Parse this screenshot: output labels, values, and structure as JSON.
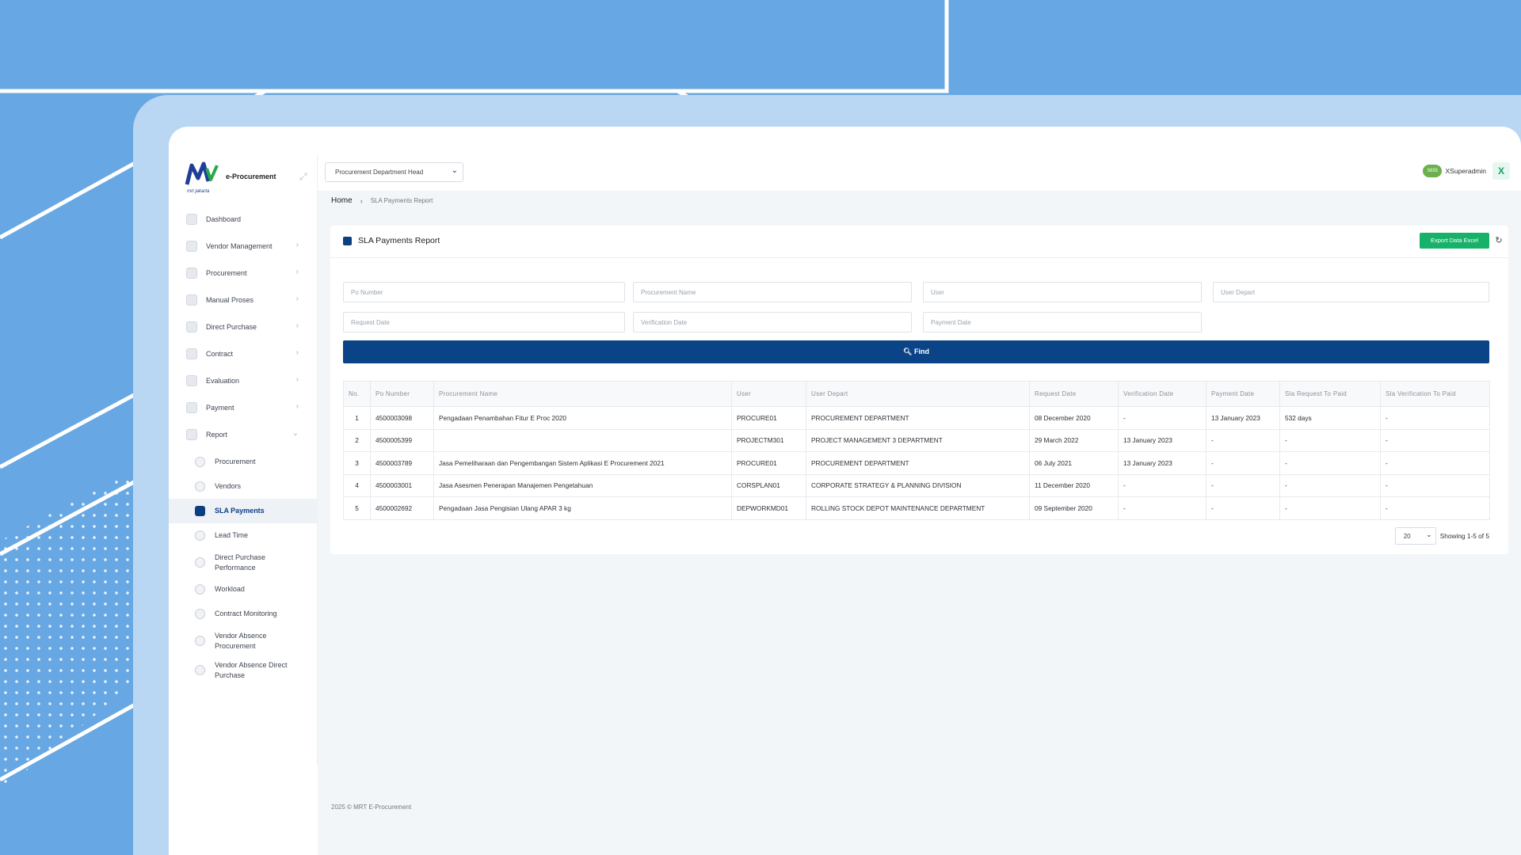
{
  "brand": {
    "name": "e-Procurement",
    "logo_text": "mrt jakarta"
  },
  "role": {
    "selected": "Procurement Department Head"
  },
  "user": {
    "badge": "5655",
    "name": "XSuperadmin",
    "close": "X"
  },
  "sidebar": {
    "items": [
      {
        "label": "Dashboard",
        "icon": "dashboard-icon",
        "chevron": ""
      },
      {
        "label": "Vendor Management",
        "icon": "globe-icon",
        "chevron": "›"
      },
      {
        "label": "Procurement",
        "icon": "globe-icon",
        "chevron": "›"
      },
      {
        "label": "Manual Proses",
        "icon": "globe-icon",
        "chevron": "›"
      },
      {
        "label": "Direct Purchase",
        "icon": "globe-icon",
        "chevron": "›"
      },
      {
        "label": "Contract",
        "icon": "edit-icon",
        "chevron": "›"
      },
      {
        "label": "Evaluation",
        "icon": "clipboard-icon",
        "chevron": "›"
      },
      {
        "label": "Payment",
        "icon": "calendar-icon",
        "chevron": "›"
      },
      {
        "label": "Report",
        "icon": "calendar-icon",
        "chevron": "⌄"
      }
    ],
    "report_sub": [
      {
        "label": "Procurement",
        "icon": "globe-icon"
      },
      {
        "label": "Vendors",
        "icon": "users-icon"
      },
      {
        "label": "SLA Payments",
        "icon": "receipt-icon",
        "active": true
      },
      {
        "label": "Lead Time",
        "icon": "clock-icon"
      },
      {
        "label": "Direct Purchase Performance",
        "icon": "chart-icon"
      },
      {
        "label": "Workload",
        "icon": "gauge-icon"
      },
      {
        "label": "Contract Monitoring",
        "icon": "copy-icon"
      },
      {
        "label": "Vendor Absence Procurement",
        "icon": "calendar-icon"
      },
      {
        "label": "Vendor Absence Direct Purchase",
        "icon": "calendar-icon"
      }
    ]
  },
  "breadcrumb": {
    "home": "Home",
    "sep": "›",
    "current": "SLA Payments Report"
  },
  "card": {
    "title": "SLA Payments Report",
    "export_label": "Export Data Excel",
    "refresh": "↻"
  },
  "filters": {
    "po_number": "Po Number",
    "procurement_name": "Procurement Name",
    "user": "User",
    "user_depart": "User Depart",
    "request_date": "Request Date",
    "verification_date": "Verification Date",
    "payment_date": "Payment Date",
    "find_label": "Find"
  },
  "table": {
    "columns": [
      "No.",
      "Po Number",
      "Procurement Name",
      "User",
      "User Depart",
      "Request Date",
      "Verification Date",
      "Payment Date",
      "Sla Request To Paid",
      "Sla Verification To Paid"
    ],
    "rows": [
      [
        "1",
        "4500003098",
        "Pengadaan Penambahan Fitur E Proc 2020",
        "PROCURE01",
        "PROCUREMENT DEPARTMENT",
        "08 December 2020",
        "-",
        "13 January 2023",
        "532 days",
        "-"
      ],
      [
        "2",
        "4500005399",
        "",
        "PROJECTM301",
        "PROJECT MANAGEMENT 3 DEPARTMENT",
        "29 March 2022",
        "13 January 2023",
        "-",
        "-",
        "-"
      ],
      [
        "3",
        "4500003789",
        "Jasa Pemeliharaan dan Pengembangan Sistem Aplikasi E Procurement 2021",
        "PROCURE01",
        "PROCUREMENT DEPARTMENT",
        "06 July 2021",
        "13 January 2023",
        "-",
        "-",
        "-"
      ],
      [
        "4",
        "4500003001",
        "Jasa Asesmen Penerapan Manajemen Pengetahuan",
        "CORSPLAN01",
        "CORPORATE STRATEGY & PLANNING DIVISION",
        "11 December 2020",
        "-",
        "-",
        "-",
        "-"
      ],
      [
        "5",
        "4500002692",
        "Pengadaan Jasa Pengisian Ulang APAR 3 kg",
        "DEPWORKMD01",
        "ROLLING STOCK DEPOT MAINTENANCE DEPARTMENT",
        "09 September 2020",
        "-",
        "-",
        "-",
        "-"
      ]
    ]
  },
  "pager": {
    "page_size": "20",
    "showing": "Showing 1-5 of 5"
  },
  "footer": {
    "text": "2025 © MRT E-Procurement"
  },
  "colors": {
    "primary": "#0b4387",
    "export": "#17b26a",
    "background": "#67a7e3"
  }
}
